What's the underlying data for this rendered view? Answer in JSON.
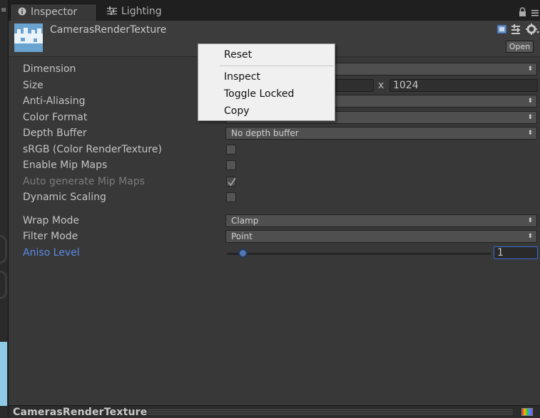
{
  "tabs": [
    {
      "label": "Inspector"
    },
    {
      "label": "Lighting"
    }
  ],
  "asset": {
    "name": "CamerasRenderTexture",
    "open_label": "Open"
  },
  "properties": {
    "dimension": {
      "label": "Dimension"
    },
    "size": {
      "label": "Size",
      "x_label": "x",
      "height": "1024"
    },
    "anti_aliasing": {
      "label": "Anti-Aliasing"
    },
    "color_format": {
      "label": "Color Format"
    },
    "depth_buffer": {
      "label": "Depth Buffer",
      "value": "No depth buffer"
    },
    "srgb": {
      "label": "sRGB (Color RenderTexture)",
      "checked": false
    },
    "enable_mip_maps": {
      "label": "Enable Mip Maps",
      "checked": false
    },
    "auto_generate_mip_maps": {
      "label": "Auto generate Mip Maps",
      "checked": true,
      "disabled": true
    },
    "dynamic_scaling": {
      "label": "Dynamic Scaling",
      "checked": false
    },
    "wrap_mode": {
      "label": "Wrap Mode",
      "value": "Clamp"
    },
    "filter_mode": {
      "label": "Filter Mode",
      "value": "Point"
    },
    "aniso_level": {
      "label": "Aniso Level",
      "value": "1",
      "slider_fraction": 0.06
    }
  },
  "context_menu": {
    "items": [
      {
        "label": "Reset"
      },
      {
        "label": "Inspect"
      },
      {
        "label": "Toggle Locked"
      },
      {
        "label": "Copy"
      }
    ]
  },
  "footer": {
    "title": "CamerasRenderTexture"
  },
  "icons": {
    "tab_inspector": "info-icon",
    "tab_lighting": "sliders-icon",
    "lock": "lock-icon",
    "tab_menu": "menu-icon",
    "help": "help-book-icon",
    "presets": "presets-icon",
    "settings": "gear-icon",
    "footer_color": "color-channels-icon"
  },
  "colors": {
    "panel_bg": "#383838",
    "active_label": "#5b8ce6",
    "menu_bg": "#f0f0f0"
  }
}
